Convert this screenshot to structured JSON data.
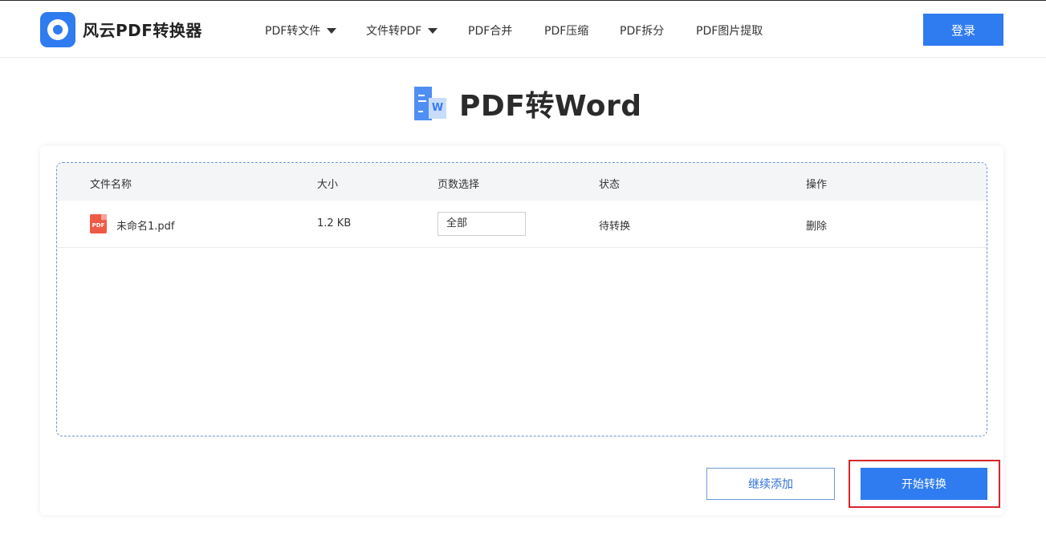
{
  "brand": {
    "name": "风云PDF转换器"
  },
  "nav": {
    "items": [
      {
        "label": "PDF转文件",
        "dropdown": true
      },
      {
        "label": "文件转PDF",
        "dropdown": true
      },
      {
        "label": "PDF合并",
        "dropdown": false
      },
      {
        "label": "PDF压缩",
        "dropdown": false
      },
      {
        "label": "PDF拆分",
        "dropdown": false
      },
      {
        "label": "PDF图片提取",
        "dropdown": false
      }
    ],
    "login_label": "登录"
  },
  "page": {
    "title": "PDF转Word",
    "icon": "word-document-icon"
  },
  "table": {
    "headers": [
      "文件名称",
      "大小",
      "页数选择",
      "状态",
      "操作"
    ],
    "rows": [
      {
        "file_icon_text": "PDF",
        "filename": "未命名1.pdf",
        "size": "1.2 KB",
        "pages": "全部",
        "status": "待转换",
        "action": "删除"
      }
    ]
  },
  "actions": {
    "add_label": "继续添加",
    "start_label": "开始转换"
  },
  "colors": {
    "accent": "#2f7bf0",
    "highlight": "#d9252b",
    "pdf_icon": "#ef5a45"
  }
}
